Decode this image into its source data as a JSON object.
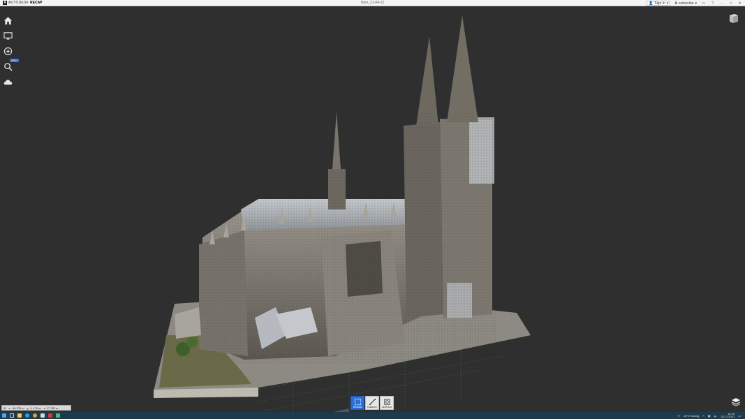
{
  "titlebar": {
    "brand_autodesk": "AUTODESK",
    "brand_recap": "RECAP",
    "document_title": "Dom_21-04-12",
    "sign_in": "Sign In",
    "subscribe": "subscribe"
  },
  "left_tools": {
    "home_icon": "home-icon",
    "display_icon": "monitor-icon",
    "navigate_icon": "compass-icon",
    "search_icon": "search-icon",
    "search_badge": "PRO",
    "cloud_icon": "cloud-icon"
  },
  "bottom_toolbar": {
    "window_label": "Window",
    "distance_label": "Distance",
    "limit_box_label": "Limit Box"
  },
  "coordinates": {
    "x": "x: -48.275 m",
    "y": "y: -1.170 m",
    "z": "z: 17.782 m"
  },
  "tray": {
    "weather": "15°C  Sonnig",
    "time": "12:10",
    "date": "02.11.2021"
  },
  "colors": {
    "viewport_bg": "#2f2f2f",
    "accent": "#2b6fd6",
    "taskbar": "#1e3a4c"
  }
}
